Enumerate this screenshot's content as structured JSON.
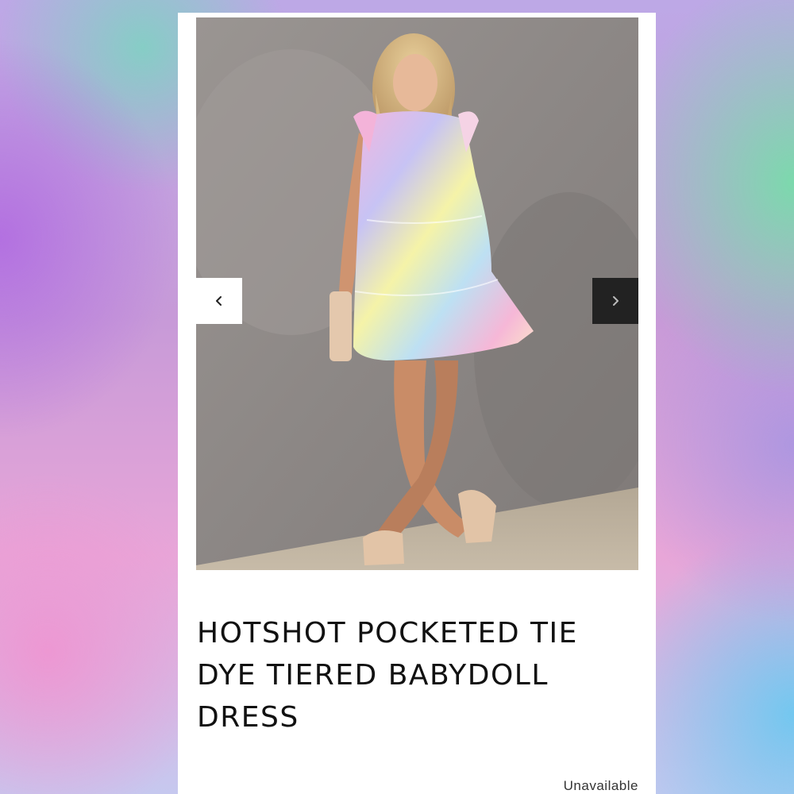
{
  "product": {
    "title": "HOTSHOT POCKETED TIE DYE TIERED BABYDOLL DRESS",
    "availability": "Unavailable"
  },
  "carousel": {
    "prev_icon": "chevron-left-icon",
    "next_icon": "chevron-right-icon"
  },
  "colors": {
    "card_background": "#ffffff",
    "prev_button": "#ffffff",
    "next_button": "#222222",
    "title_text": "#111111"
  }
}
